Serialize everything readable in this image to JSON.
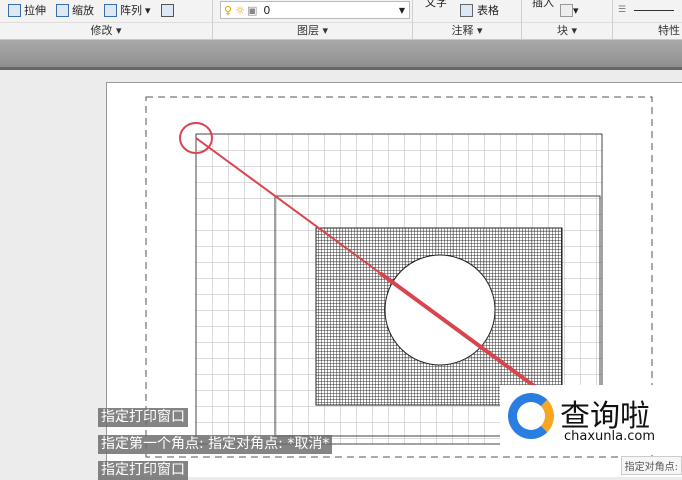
{
  "ribbon": {
    "modify": {
      "stretch": "拉伸",
      "scale": "缩放",
      "array": "阵列",
      "label": "修改 ▾"
    },
    "layers": {
      "current_layer": "0",
      "label": "图层 ▾"
    },
    "annotation": {
      "text": "文字",
      "table": "表格",
      "label": "注释 ▾"
    },
    "block": {
      "insert": "插入",
      "label": "块 ▾"
    },
    "properties": {
      "label": "特性"
    }
  },
  "command_lines": [
    "指定打印窗口",
    "指定第一个角点: 指定对角点: *取消*",
    "指定打印窗口"
  ],
  "tooltip": "指定对角点:",
  "watermark": {
    "name": "查询啦",
    "domain": "chaxunla.com"
  },
  "colors": {
    "highlight": "#d9454f",
    "accent": "#2a7de1"
  }
}
